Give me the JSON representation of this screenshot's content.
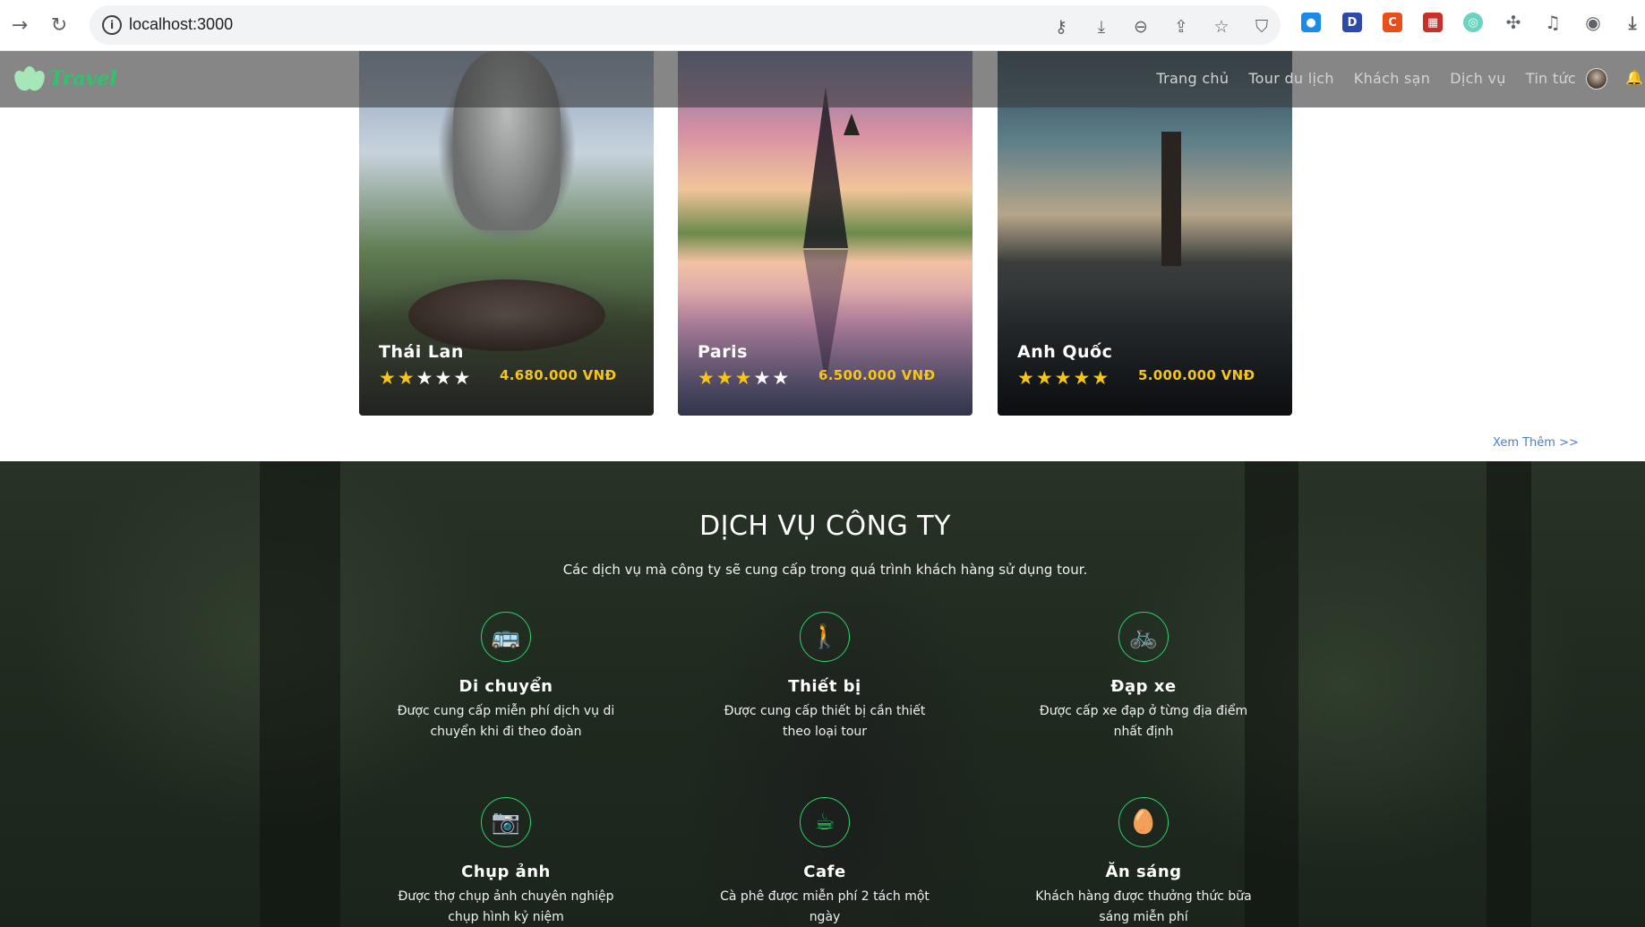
{
  "browser": {
    "url": "localhost:3000"
  },
  "site": {
    "logo_text": "Travel",
    "nav": [
      "Trang chủ",
      "Tour du lịch",
      "Khách sạn",
      "Dịch vụ",
      "Tin tức"
    ]
  },
  "tours": [
    {
      "name": "Thái Lan",
      "rating": 2,
      "price": "4.680.000 VNĐ"
    },
    {
      "name": "Paris",
      "rating": 3,
      "price": "6.500.000 VNĐ"
    },
    {
      "name": "Anh Quốc",
      "rating": 5,
      "price": "5.000.000 VNĐ"
    }
  ],
  "more_link": "Xem Thêm >>",
  "services": {
    "title": "DỊCH VỤ CÔNG TY",
    "subtitle": "Các dịch vụ mà công ty sẽ cung cấp trong quá trình khách hàng sử dụng tour.",
    "items": [
      {
        "icon": "bus-icon",
        "name": "Di chuyển",
        "desc": "Được cung cấp miễn phí dịch vụ di chuyển khi đi theo đoàn"
      },
      {
        "icon": "hiking-icon",
        "name": "Thiết bị",
        "desc": "Được cung cấp thiết bị cần thiết theo loại tour"
      },
      {
        "icon": "bicycle-icon",
        "name": "Đạp xe",
        "desc": "Được cấp xe đạp ở từng địa điểm nhất định"
      },
      {
        "icon": "camera-icon",
        "name": "Chụp ảnh",
        "desc": "Được thợ chụp ảnh chuyên nghiệp chụp hình kỷ niệm"
      },
      {
        "icon": "coffee-icon",
        "name": "Cafe",
        "desc": "Cà phê được miễn phí 2 tách một ngày"
      },
      {
        "icon": "egg-icon",
        "name": "Ăn sáng",
        "desc": "Khách hàng được thưởng thức bữa sáng miễn phí"
      }
    ]
  },
  "colors": {
    "accent_green": "#2bd36b",
    "star_gold": "#f5c518",
    "link_blue": "#4a7fc4"
  }
}
